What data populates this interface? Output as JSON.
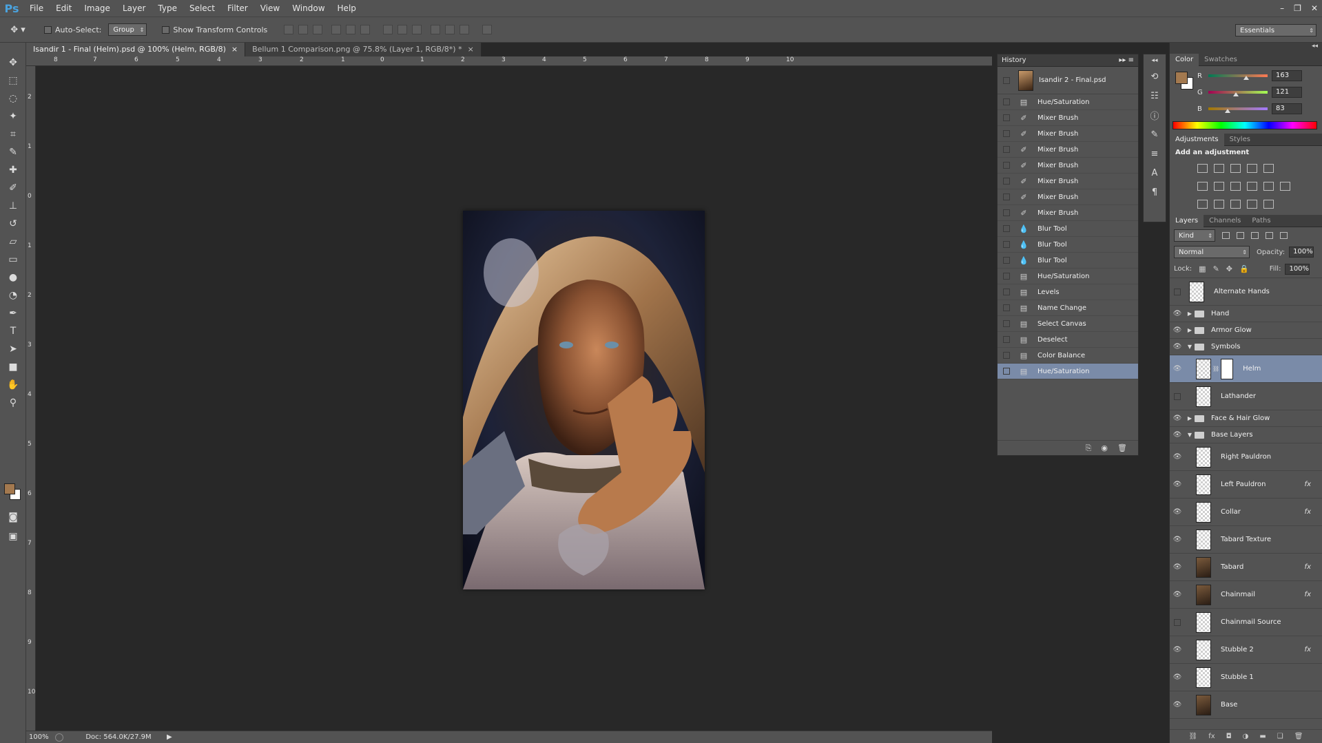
{
  "app": {
    "logo": "Ps"
  },
  "menu": [
    "File",
    "Edit",
    "Image",
    "Layer",
    "Type",
    "Select",
    "Filter",
    "View",
    "Window",
    "Help"
  ],
  "window_controls": {
    "minimize": "–",
    "restore": "❐",
    "close": "✕"
  },
  "options": {
    "auto_select_label": "Auto-Select:",
    "auto_select_value": "Group",
    "transform_label": "Show Transform Controls",
    "workspace": "Essentials"
  },
  "tabs": [
    {
      "label": "Isandir 1 - Final (Helm).psd @ 100% (Helm, RGB/8)",
      "close": "×"
    },
    {
      "label": "Bellum 1 Comparison.png @ 75.8% (Layer 1, RGB/8*) *",
      "close": "×"
    }
  ],
  "ruler": {
    "h": [
      "8",
      "7",
      "6",
      "5",
      "4",
      "3",
      "2",
      "1",
      "0",
      "1",
      "2",
      "3",
      "4",
      "5",
      "6",
      "7",
      "8",
      "9",
      "10"
    ],
    "v": [
      "2",
      "1",
      "0",
      "1",
      "2",
      "3",
      "4",
      "5",
      "6",
      "7",
      "8",
      "9",
      "10"
    ]
  },
  "status": {
    "zoom": "100%",
    "doc": "Doc: 564.0K/27.9M",
    "arrow": "▶"
  },
  "history": {
    "title": "History",
    "snapshot": "Isandir 2 - Final.psd",
    "items": [
      {
        "label": "Hue/Saturation",
        "icon": "doc-icon"
      },
      {
        "label": "Mixer Brush",
        "icon": "brush-icon"
      },
      {
        "label": "Mixer Brush",
        "icon": "brush-icon"
      },
      {
        "label": "Mixer Brush",
        "icon": "brush-icon"
      },
      {
        "label": "Mixer Brush",
        "icon": "brush-icon"
      },
      {
        "label": "Mixer Brush",
        "icon": "brush-icon"
      },
      {
        "label": "Mixer Brush",
        "icon": "brush-icon"
      },
      {
        "label": "Mixer Brush",
        "icon": "brush-icon"
      },
      {
        "label": "Blur Tool",
        "icon": "drop-icon"
      },
      {
        "label": "Blur Tool",
        "icon": "drop-icon"
      },
      {
        "label": "Blur Tool",
        "icon": "drop-icon"
      },
      {
        "label": "Hue/Saturation",
        "icon": "doc-icon"
      },
      {
        "label": "Levels",
        "icon": "doc-icon"
      },
      {
        "label": "Name Change",
        "icon": "doc-icon"
      },
      {
        "label": "Select Canvas",
        "icon": "doc-icon"
      },
      {
        "label": "Deselect",
        "icon": "doc-icon"
      },
      {
        "label": "Color Balance",
        "icon": "doc-icon"
      },
      {
        "label": "Hue/Saturation",
        "icon": "doc-icon",
        "active": true
      }
    ]
  },
  "color": {
    "tabs": [
      "Color",
      "Swatches"
    ],
    "fg": "#a3794f",
    "r": {
      "label": "R",
      "value": "163",
      "level": 0.64
    },
    "g": {
      "label": "G",
      "value": "121",
      "level": 0.47
    },
    "b": {
      "label": "B",
      "value": "83",
      "level": 0.33
    }
  },
  "adjustments": {
    "tabs": [
      "Adjustments",
      "Styles"
    ],
    "heading": "Add an adjustment"
  },
  "layers": {
    "tabs": [
      "Layers",
      "Channels",
      "Paths"
    ],
    "kind": "Kind",
    "blend": "Normal",
    "opacity_label": "Opacity:",
    "opacity": "100%",
    "lock_label": "Lock:",
    "fill_label": "Fill:",
    "fill": "100%",
    "fx_label": "fx",
    "items": [
      {
        "name": "Alternate Hands",
        "type": "layer",
        "visible": false,
        "depth": 0
      },
      {
        "name": "Hand",
        "type": "group",
        "visible": true,
        "open": false
      },
      {
        "name": "Armor Glow",
        "type": "group",
        "visible": true,
        "open": false
      },
      {
        "name": "Symbols",
        "type": "group",
        "visible": true,
        "open": true
      },
      {
        "name": "Helm",
        "type": "layer",
        "visible": true,
        "depth": 1,
        "active": true,
        "mask": true
      },
      {
        "name": "Lathander",
        "type": "layer",
        "visible": false,
        "depth": 1
      },
      {
        "name": "Face & Hair Glow",
        "type": "group",
        "visible": true,
        "open": false
      },
      {
        "name": "Base Layers",
        "type": "group",
        "visible": true,
        "open": true
      },
      {
        "name": "Right Pauldron",
        "type": "layer",
        "visible": true,
        "depth": 1
      },
      {
        "name": "Left Pauldron",
        "type": "layer",
        "visible": true,
        "depth": 1,
        "fx": true
      },
      {
        "name": "Collar",
        "type": "layer",
        "visible": true,
        "depth": 1,
        "fx": true
      },
      {
        "name": "Tabard Texture",
        "type": "layer",
        "visible": true,
        "depth": 1
      },
      {
        "name": "Tabard",
        "type": "layer",
        "visible": true,
        "depth": 1,
        "fx": true,
        "dark": true
      },
      {
        "name": "Chainmail",
        "type": "layer",
        "visible": true,
        "depth": 1,
        "fx": true,
        "dark": true
      },
      {
        "name": "Chainmail Source",
        "type": "layer",
        "visible": false,
        "depth": 1
      },
      {
        "name": "Stubble 2",
        "type": "layer",
        "visible": true,
        "depth": 1,
        "fx": true
      },
      {
        "name": "Stubble 1",
        "type": "layer",
        "visible": true,
        "depth": 1
      },
      {
        "name": "Base",
        "type": "layer",
        "visible": true,
        "depth": 1,
        "dark": true
      }
    ]
  }
}
